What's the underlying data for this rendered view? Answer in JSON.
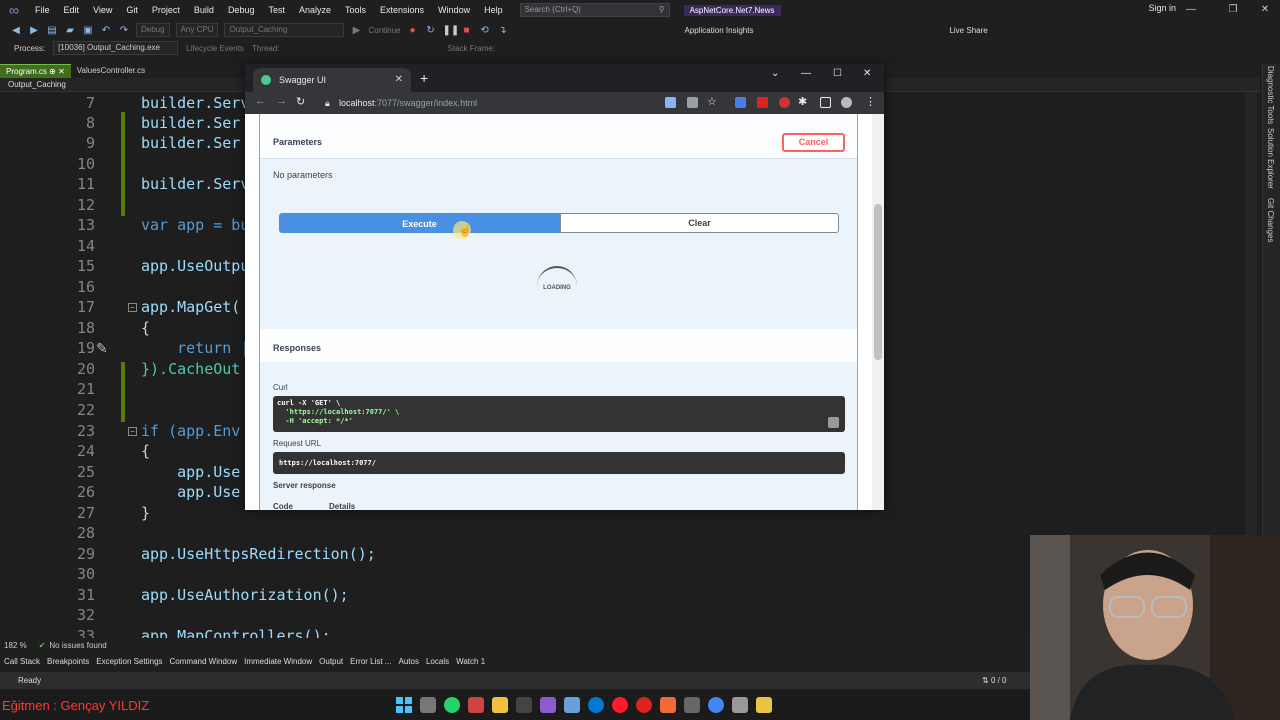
{
  "vs": {
    "menu": [
      "File",
      "Edit",
      "View",
      "Git",
      "Project",
      "Build",
      "Debug",
      "Test",
      "Analyze",
      "Tools",
      "Extensions",
      "Window",
      "Help"
    ],
    "search_placeholder": "Search (Ctrl+Q)",
    "solution": "AspNetCore.Net7.News",
    "signin": "Sign in",
    "toolbar": {
      "config": "Debug",
      "platform": "Any CPU",
      "startup": "Output_Caching",
      "continue": "Continue",
      "app_insights": "Application Insights",
      "live_share": "Live Share"
    },
    "process_label": "Process:",
    "process_value": "[10036] Output_Caching.exe",
    "lifecycle": "Lifecycle Events",
    "thread": "Thread:",
    "stack_frame": "Stack Frame:",
    "tabs": [
      {
        "label": "Program.cs"
      },
      {
        "label": "ValuesController.cs"
      }
    ],
    "nav_project": "Output_Caching",
    "right_dock": [
      "Diagnostic Tools",
      "Solution Explorer",
      "Git Changes"
    ],
    "zoom": "182 %",
    "issues": "No issues found",
    "tool_windows": [
      "Call Stack",
      "Breakpoints",
      "Exception Settings",
      "Command Window",
      "Immediate Window",
      "Output",
      "Error List ...",
      "Autos",
      "Locals",
      "Watch 1"
    ],
    "status": "Ready",
    "status_right": "0 / 0",
    "instructor": "Eğitmen : Gençay YILDIZ"
  },
  "code": [
    {
      "n": "7",
      "t": "builder.Serv"
    },
    {
      "n": "8",
      "t": "builder.Ser"
    },
    {
      "n": "9",
      "t": "builder.Ser"
    },
    {
      "n": "10",
      "t": ""
    },
    {
      "n": "11",
      "t": "builder.Serv"
    },
    {
      "n": "12",
      "t": ""
    },
    {
      "n": "13",
      "t": "var app = bu"
    },
    {
      "n": "14",
      "t": ""
    },
    {
      "n": "15",
      "t": "app.UseOutpu"
    },
    {
      "n": "16",
      "t": ""
    },
    {
      "n": "17",
      "t": "app.MapGet("
    },
    {
      "n": "18",
      "t": "{"
    },
    {
      "n": "19",
      "t": "    return |"
    },
    {
      "n": "20",
      "t": "}).CacheOut"
    },
    {
      "n": "21",
      "t": ""
    },
    {
      "n": "22",
      "t": ""
    },
    {
      "n": "23",
      "t": "if (app.Env"
    },
    {
      "n": "24",
      "t": "{"
    },
    {
      "n": "25",
      "t": "    app.Use"
    },
    {
      "n": "26",
      "t": "    app.Use"
    },
    {
      "n": "27",
      "t": "}"
    },
    {
      "n": "28",
      "t": ""
    },
    {
      "n": "29",
      "t": "app.UseHttpsRedirection();"
    },
    {
      "n": "30",
      "t": ""
    },
    {
      "n": "31",
      "t": "app.UseAuthorization();"
    },
    {
      "n": "32",
      "t": ""
    },
    {
      "n": "33",
      "t": "app.MapControllers();"
    }
  ],
  "browser": {
    "tab_title": "Swagger UI",
    "url_host": "localhost",
    "url_rest": ":7077/swagger/index.html"
  },
  "swagger": {
    "parameters_title": "Parameters",
    "cancel": "Cancel",
    "no_params": "No parameters",
    "execute": "Execute",
    "clear": "Clear",
    "loading": "LOADING",
    "responses_title": "Responses",
    "curl_label": "Curl",
    "curl_line1": "curl -X 'GET' \\",
    "curl_line2": "  'https://localhost:7077/' \\",
    "curl_line3": "  -H 'accept: */*'",
    "request_url_label": "Request URL",
    "request_url": "https://localhost:7077/",
    "server_response_label": "Server response",
    "code_col": "Code",
    "details_col": "Details"
  }
}
